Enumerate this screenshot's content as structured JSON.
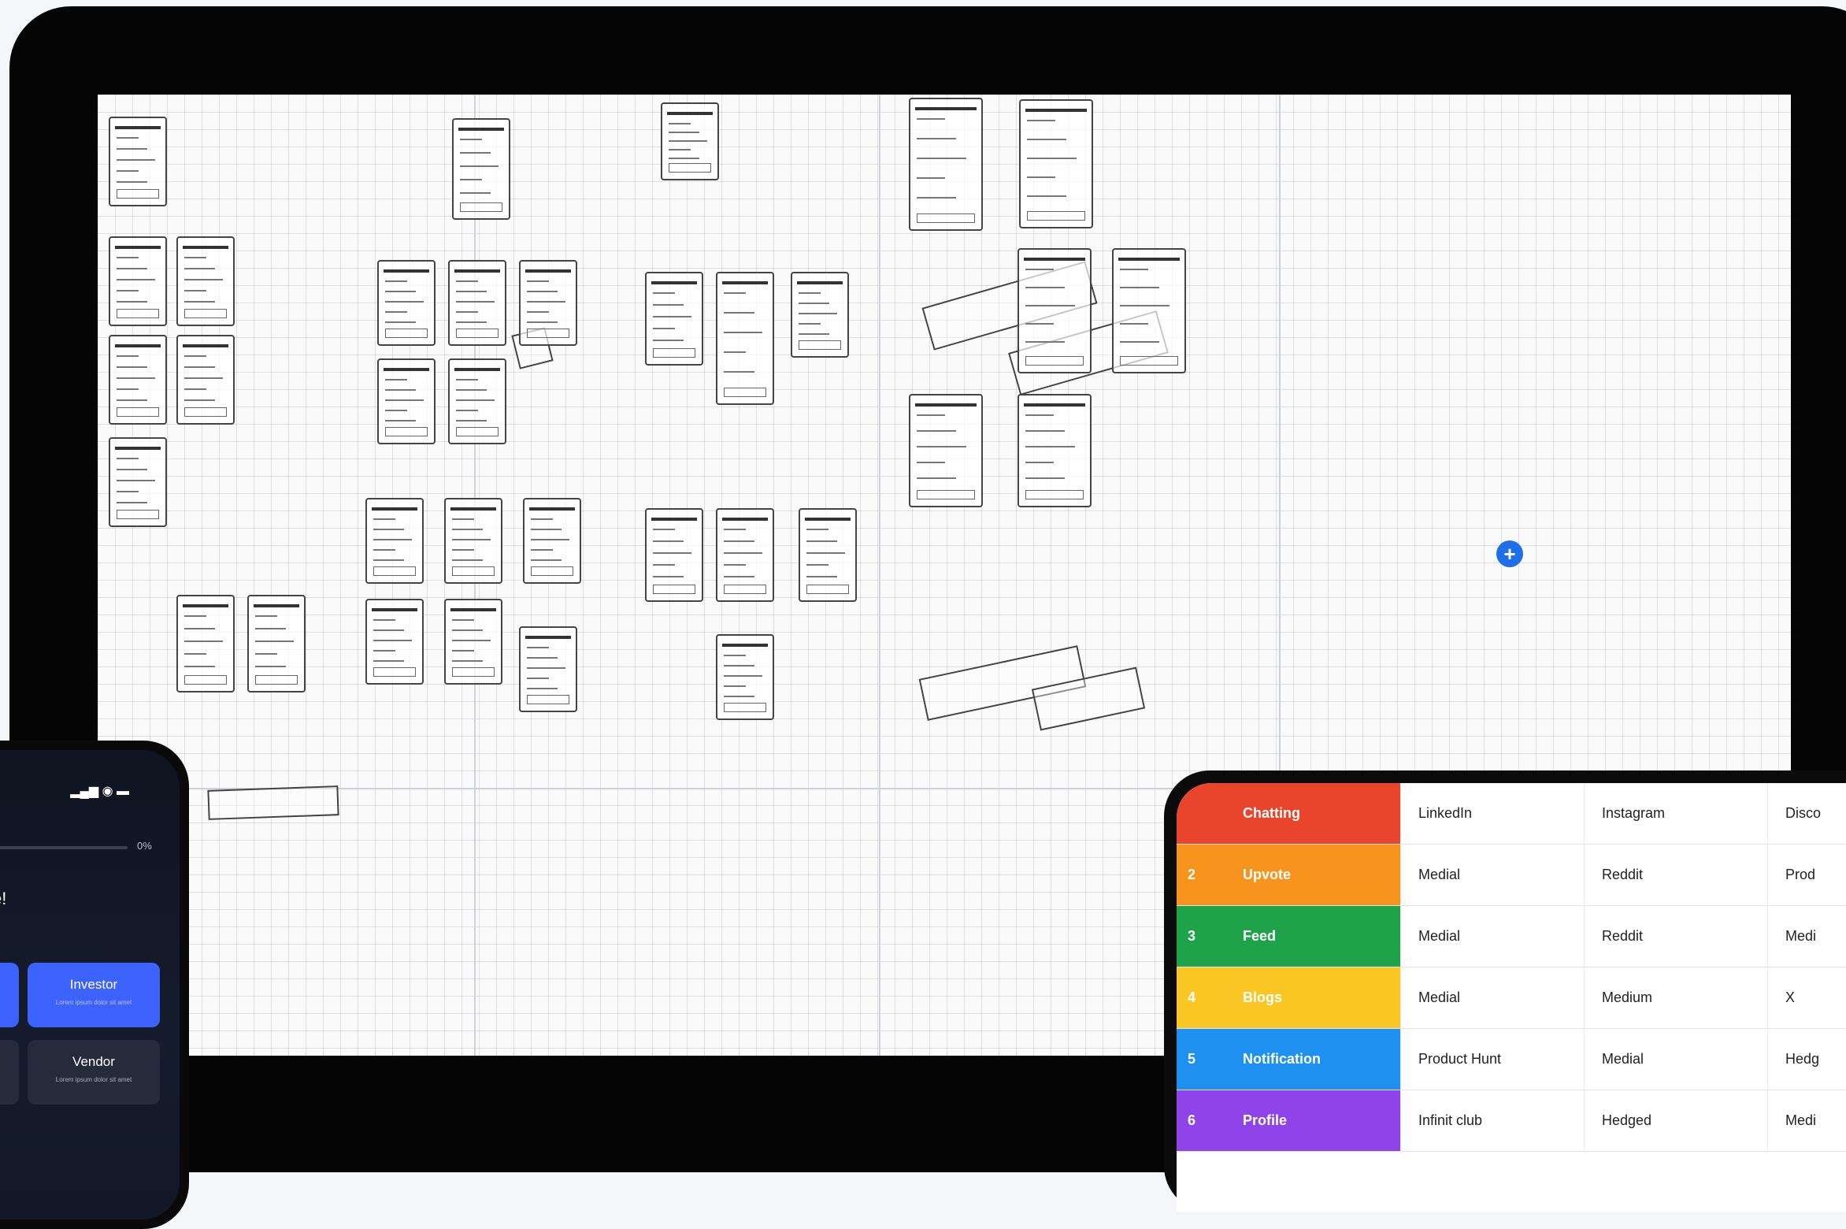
{
  "phone": {
    "progress": {
      "percent_label": "0%",
      "value": 0
    },
    "welcome_fragment": "e!",
    "cards": [
      {
        "title": "Investor",
        "subtitle": "Lorem ipsum dolor sit amet",
        "selected": true
      },
      {
        "title": "Vendor",
        "subtitle": "Lorem ipsum dolor sit amet",
        "selected": false
      }
    ]
  },
  "table": {
    "rows": [
      {
        "num": "",
        "feature": "Chatting",
        "color": "#e8452c",
        "a": "LinkedIn",
        "b": "Instagram",
        "c": "Disco"
      },
      {
        "num": "2",
        "feature": "Upvote",
        "color": "#f7941d",
        "a": "Medial",
        "b": "Reddit",
        "c": "Prod"
      },
      {
        "num": "3",
        "feature": "Feed",
        "color": "#1fa34a",
        "a": "Medial",
        "b": "Reddit",
        "c": "Medi"
      },
      {
        "num": "4",
        "feature": "Blogs",
        "color": "#f9c623",
        "a": "Medial",
        "b": "Medium",
        "c": "X"
      },
      {
        "num": "5",
        "feature": "Notification",
        "color": "#1e90f0",
        "a": "Product Hunt",
        "b": "Medial",
        "c": "Hedg"
      },
      {
        "num": "6",
        "feature": "Profile",
        "color": "#8e44e8",
        "a": "Infinit club",
        "b": "Hedged",
        "c": "Medi"
      }
    ]
  }
}
